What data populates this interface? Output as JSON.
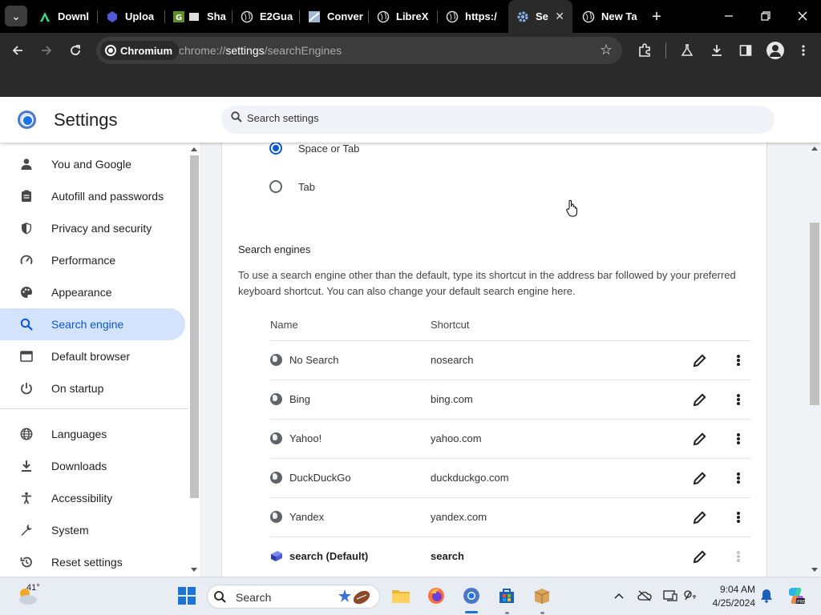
{
  "browser": {
    "tabs": [
      {
        "label": "Downl",
        "icon": "android-studio-icon"
      },
      {
        "label": "Uploa",
        "icon": "upload-icon"
      },
      {
        "label": "Sha",
        "icon": "sharing-icon"
      },
      {
        "label": "E2Gua",
        "icon": "globe-icon"
      },
      {
        "label": "Conver",
        "icon": "converter-icon"
      },
      {
        "label": "LibreX",
        "icon": "globe-icon"
      },
      {
        "label": "https:/",
        "icon": "globe-icon"
      },
      {
        "label": "Se",
        "icon": "gear-icon"
      },
      {
        "label": "New Ta",
        "icon": "globe-icon"
      }
    ],
    "site_chip": "Chromium",
    "url_prefix": "chrome://",
    "url_host": "settings",
    "url_path": "/searchEngines",
    "tab_close": "✕",
    "new_tab": "+"
  },
  "settings": {
    "title": "Settings",
    "search_placeholder": "Search settings",
    "nav": [
      {
        "label": "You and Google",
        "icon": "person-icon"
      },
      {
        "label": "Autofill and passwords",
        "icon": "clipboard-icon"
      },
      {
        "label": "Privacy and security",
        "icon": "shield-icon"
      },
      {
        "label": "Performance",
        "icon": "speedometer-icon"
      },
      {
        "label": "Appearance",
        "icon": "palette-icon"
      },
      {
        "label": "Search engine",
        "icon": "search-icon",
        "active": true
      },
      {
        "label": "Default browser",
        "icon": "browser-icon"
      },
      {
        "label": "On startup",
        "icon": "power-icon"
      },
      {
        "label": "Languages",
        "icon": "globe-icon"
      },
      {
        "label": "Downloads",
        "icon": "download-icon"
      },
      {
        "label": "Accessibility",
        "icon": "accessibility-icon"
      },
      {
        "label": "System",
        "icon": "wrench-icon"
      },
      {
        "label": "Reset settings",
        "icon": "reset-icon"
      }
    ],
    "radio_options": [
      {
        "label": "Space or Tab",
        "checked": true
      },
      {
        "label": "Tab",
        "checked": false
      }
    ],
    "section_title": "Search engines",
    "section_description": "To use a search engine other than the default, type its shortcut in the address bar followed by your preferred keyboard shortcut. You can also change your default search engine here.",
    "columns": {
      "name": "Name",
      "shortcut": "Shortcut"
    },
    "engines": [
      {
        "name": "No Search",
        "shortcut": "nosearch",
        "bold": false
      },
      {
        "name": "Bing",
        "shortcut": "bing.com",
        "bold": false
      },
      {
        "name": "Yahoo!",
        "shortcut": "yahoo.com",
        "bold": false
      },
      {
        "name": "DuckDuckGo",
        "shortcut": "duckduckgo.com",
        "bold": false
      },
      {
        "name": "Yandex",
        "shortcut": "yandex.com",
        "bold": false
      },
      {
        "name": "search (Default)",
        "shortcut": "search",
        "bold": true
      }
    ],
    "accent_color": "#0b57d0",
    "active_nav_bg": "#d3e3fd"
  },
  "taskbar": {
    "weather_temp": "41°",
    "search_label": "Search",
    "time": "9:04 AM",
    "date": "4/25/2024"
  }
}
